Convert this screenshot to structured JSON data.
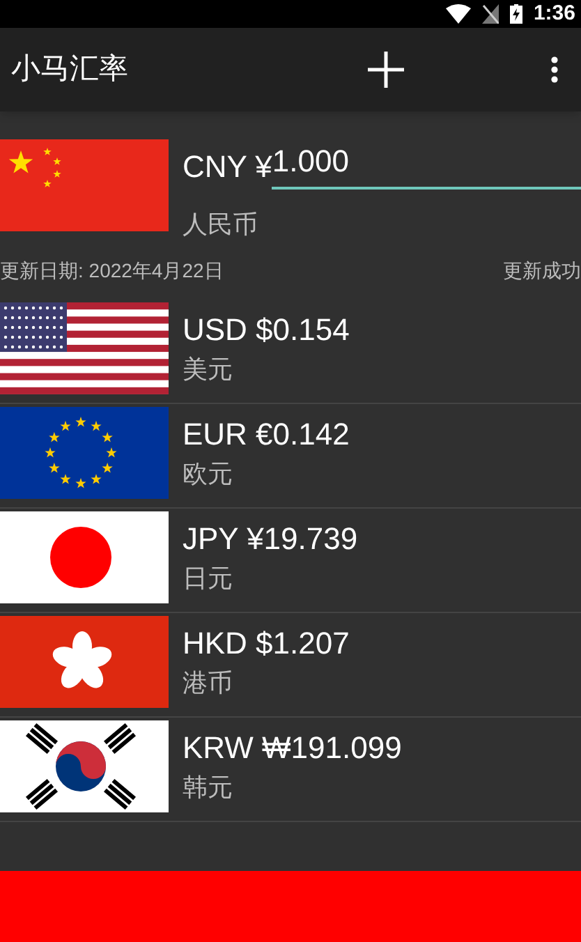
{
  "status_bar": {
    "time": "1:36"
  },
  "app_bar": {
    "title": "小马汇率"
  },
  "base": {
    "kind": "cn",
    "code": "CNY ¥",
    "amount": "1.000",
    "name": "人民币"
  },
  "update": {
    "date": "更新日期: 2022年4月22日",
    "status": "更新成功"
  },
  "currencies": [
    {
      "kind": "us",
      "rate": "USD $0.154",
      "name": "美元"
    },
    {
      "kind": "eu",
      "rate": "EUR €0.142",
      "name": "欧元"
    },
    {
      "kind": "jp",
      "rate": "JPY ¥19.739",
      "name": "日元"
    },
    {
      "kind": "hk",
      "rate": "HKD $1.207",
      "name": "港币"
    },
    {
      "kind": "kr",
      "rate": "KRW ₩191.099",
      "name": "韩元"
    }
  ]
}
